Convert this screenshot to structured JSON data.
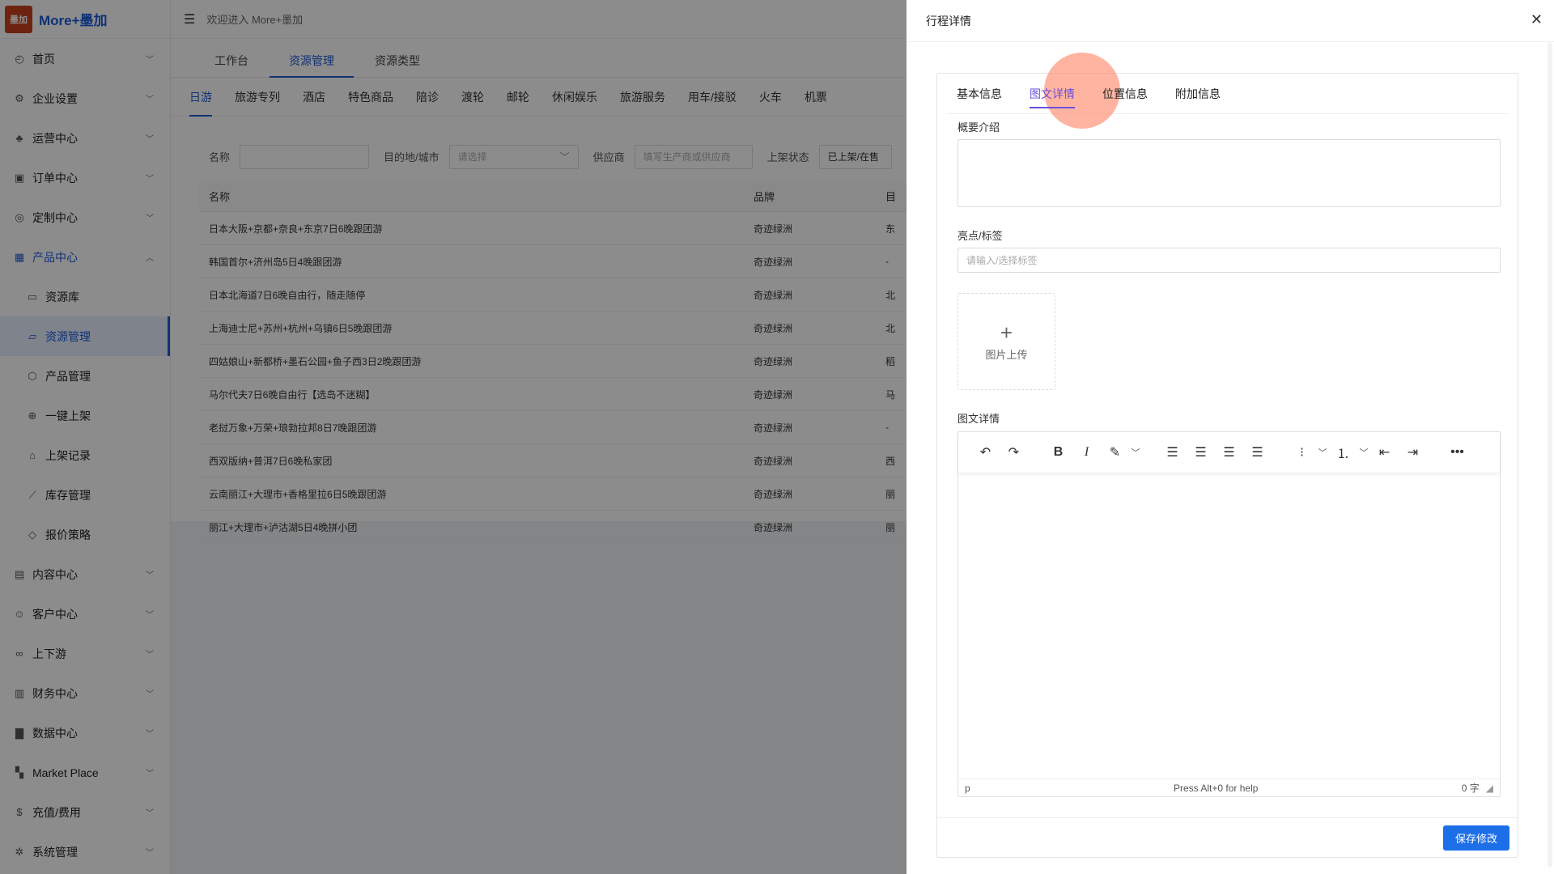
{
  "brand": {
    "logo_text": "墨加",
    "name": "More+墨加"
  },
  "sidebar": {
    "items": [
      {
        "label": "首页",
        "icon": "dashboard-icon"
      },
      {
        "label": "企业设置",
        "icon": "gear-icon"
      },
      {
        "label": "运营中心",
        "icon": "android-icon"
      },
      {
        "label": "订单中心",
        "icon": "order-icon"
      },
      {
        "label": "定制中心",
        "icon": "compass-icon"
      },
      {
        "label": "产品中心",
        "icon": "grid-icon"
      },
      {
        "label": "资源库",
        "icon": "folder-icon"
      },
      {
        "label": "资源管理",
        "icon": "folder-open-icon"
      },
      {
        "label": "产品管理",
        "icon": "cube-icon"
      },
      {
        "label": "一键上架",
        "icon": "target-icon"
      },
      {
        "label": "上架记录",
        "icon": "bag-icon"
      },
      {
        "label": "库存管理",
        "icon": "chart-line-icon"
      },
      {
        "label": "报价策略",
        "icon": "tag-icon"
      },
      {
        "label": "内容中心",
        "icon": "document-icon"
      },
      {
        "label": "客户中心",
        "icon": "wechat-icon"
      },
      {
        "label": "上下游",
        "icon": "link-icon"
      },
      {
        "label": "财务中心",
        "icon": "ledger-icon"
      },
      {
        "label": "数据中心",
        "icon": "bar-chart-icon"
      },
      {
        "label": "Market Place",
        "icon": "apps-icon"
      },
      {
        "label": "充值/费用",
        "icon": "coin-icon"
      },
      {
        "label": "系统管理",
        "icon": "settings-icon"
      }
    ]
  },
  "topbar": {
    "welcome": "欢迎进入 More+墨加"
  },
  "tabs1": [
    "工作台",
    "资源管理",
    "资源类型"
  ],
  "tabs2": [
    "日游",
    "旅游专列",
    "酒店",
    "特色商品",
    "陪诊",
    "渡轮",
    "邮轮",
    "休闲娱乐",
    "旅游服务",
    "用车/接驳",
    "火车",
    "机票"
  ],
  "filters": {
    "name_label": "名称",
    "dest_label": "目的地/城市",
    "dest_placeholder": "请选择",
    "supplier_label": "供应商",
    "supplier_placeholder": "填写生产商或供应商",
    "status_label": "上架状态",
    "status_value": "已上架/在售"
  },
  "table": {
    "headers": [
      "名称",
      "品牌",
      "目"
    ],
    "rows": [
      [
        "日本大阪+京都+奈良+东京7日6晚跟团游",
        "奇迹绿洲",
        "东"
      ],
      [
        "韩国首尔+济州岛5日4晚跟团游",
        "奇迹绿洲",
        "-"
      ],
      [
        "日本北海道7日6晚自由行，随走随停",
        "奇迹绿洲",
        "北"
      ],
      [
        "上海迪士尼+苏州+杭州+乌镇6日5晚跟团游",
        "奇迹绿洲",
        "北"
      ],
      [
        "四姑娘山+新都桥+墨石公园+鱼子西3日2晚跟团游",
        "奇迹绿洲",
        "稻"
      ],
      [
        "马尔代夫7日6晚自由行【选岛不迷糊】",
        "奇迹绿洲",
        "马"
      ],
      [
        "老挝万象+万荣+琅勃拉邦8日7晚跟团游",
        "奇迹绿洲",
        "-"
      ],
      [
        "西双版纳+普洱7日6晚私家团",
        "奇迹绿洲",
        "西"
      ],
      [
        "云南丽江+大理市+香格里拉6日5晚跟团游",
        "奇迹绿洲",
        "丽"
      ],
      [
        "丽江+大理市+泸沽湖5日4晚拼小团",
        "奇迹绿洲",
        "丽"
      ]
    ]
  },
  "drawer": {
    "title": "行程详情",
    "close": "✕",
    "tabs": [
      "基本信息",
      "图文详情",
      "位置信息",
      "附加信息"
    ],
    "summary_label": "概要介绍",
    "tags_label": "亮点/标签",
    "tags_placeholder": "请输入/选择标签",
    "upload_plus": "+",
    "upload_text": "图片上传",
    "detail_label": "图文详情",
    "status_left": "p",
    "status_help": "Press Alt+0 for help",
    "status_count": "0 字",
    "save_label": "保存修改"
  }
}
